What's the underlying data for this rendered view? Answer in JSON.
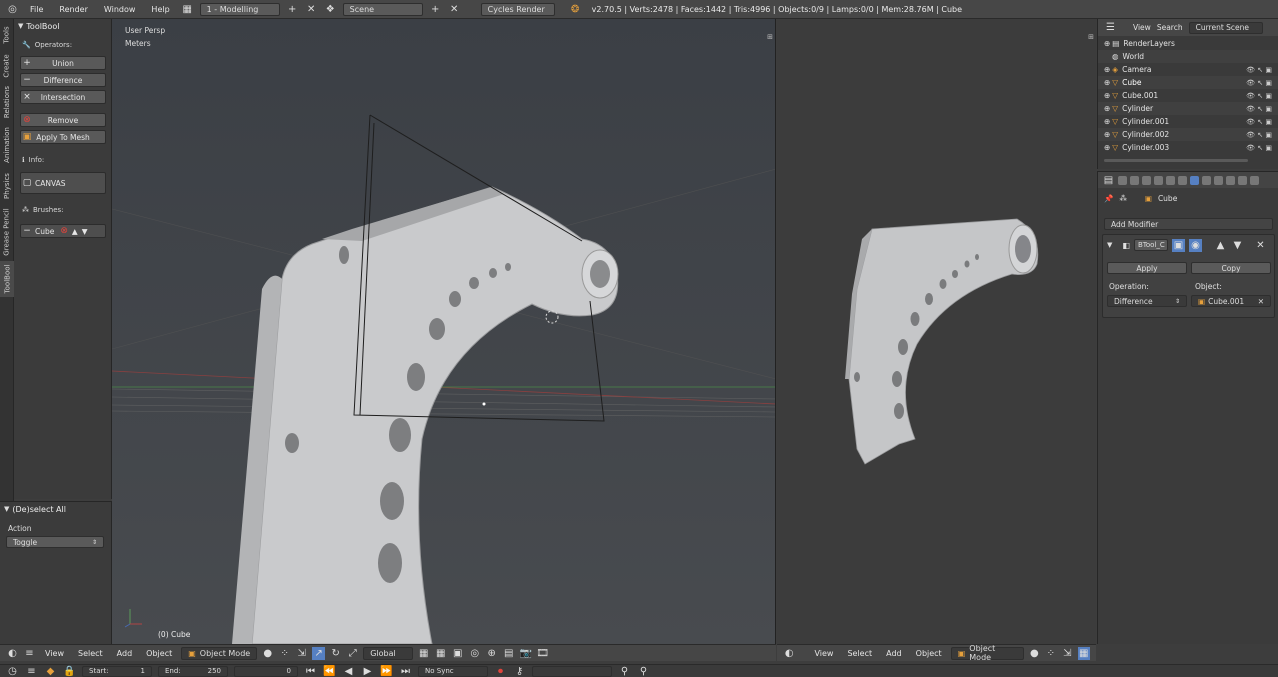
{
  "top_bar": {
    "menus": [
      "File",
      "Render",
      "Window",
      "Help"
    ],
    "screen_layout": "1 - Modelling",
    "scene": "Scene",
    "engine": "Cycles Render",
    "stats": "v2.70.5 | Verts:2478 | Faces:1442 | Tris:4996 | Objects:0/9 | Lamps:0/0 | Mem:28.76M | Cube"
  },
  "tool_tabs": [
    "Tools",
    "Create",
    "Relations",
    "Animation",
    "Physics",
    "Grease Pencil",
    "ToolBool"
  ],
  "toolbool": {
    "title": "ToolBool",
    "operators_label": "Operators:",
    "union": "Union",
    "difference": "Difference",
    "intersection": "Intersection",
    "remove": "Remove",
    "apply_to_mesh": "Apply To Mesh",
    "info_label": "Info:",
    "canvas": "CANVAS",
    "brushes_label": "Brushes:",
    "brush_name": "Cube"
  },
  "deselect_panel": {
    "title": "(De)select All",
    "action_label": "Action",
    "action_value": "Toggle"
  },
  "viewport": {
    "persp": "User Persp",
    "units": "Meters",
    "object_label": "(0) Cube"
  },
  "viewport_header_main": {
    "items": [
      "View",
      "Select",
      "Add",
      "Object"
    ],
    "mode": "Object Mode",
    "orientation": "Global"
  },
  "viewport_header_right": {
    "items": [
      "View",
      "Select",
      "Add",
      "Object"
    ],
    "mode": "Object Mode"
  },
  "timeline": {
    "start_label": "Start:",
    "start": "1",
    "end_label": "End:",
    "end": "250",
    "frame": "0",
    "sync": "No Sync"
  },
  "outliner": {
    "view": "View",
    "search": "Search",
    "scene_filter": "Current Scene",
    "rows": [
      "RenderLayers",
      "World",
      "Camera",
      "Cube",
      "Cube.001",
      "Cylinder",
      "Cylinder.001",
      "Cylinder.002",
      "Cylinder.003"
    ]
  },
  "properties": {
    "object_name": "Cube",
    "add_modifier": "Add Modifier",
    "modifier_name": "BTool_C",
    "apply": "Apply",
    "copy": "Copy",
    "operation_label": "Operation:",
    "operation_value": "Difference",
    "object_label": "Object:",
    "object_value": "Cube.001"
  }
}
